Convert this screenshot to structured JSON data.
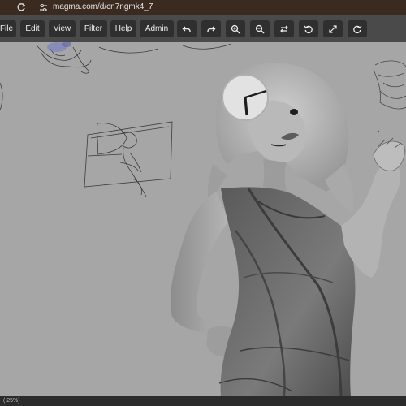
{
  "browser": {
    "url": "magma.com/d/cn7ngmk4_7",
    "reload_icon": "reload-icon",
    "site_info_icon": "site-info-icon"
  },
  "toolbar": {
    "menus": [
      "File",
      "Edit",
      "View",
      "Filter",
      "Help",
      "Admin"
    ],
    "tools": [
      "undo-icon",
      "redo-icon",
      "zoom-in-icon",
      "zoom-out-icon",
      "flip-icon",
      "rotate-left-icon",
      "fullscreen-icon",
      "rotate-right-icon"
    ]
  },
  "status": {
    "zoom_partial": "( 25%)"
  },
  "colors": {
    "toolbar_bg": "#4a4a4a",
    "button_bg": "#2f2f2f",
    "canvas_bg": "#a6a6a6",
    "browser_bar": "#3a2a1f"
  }
}
